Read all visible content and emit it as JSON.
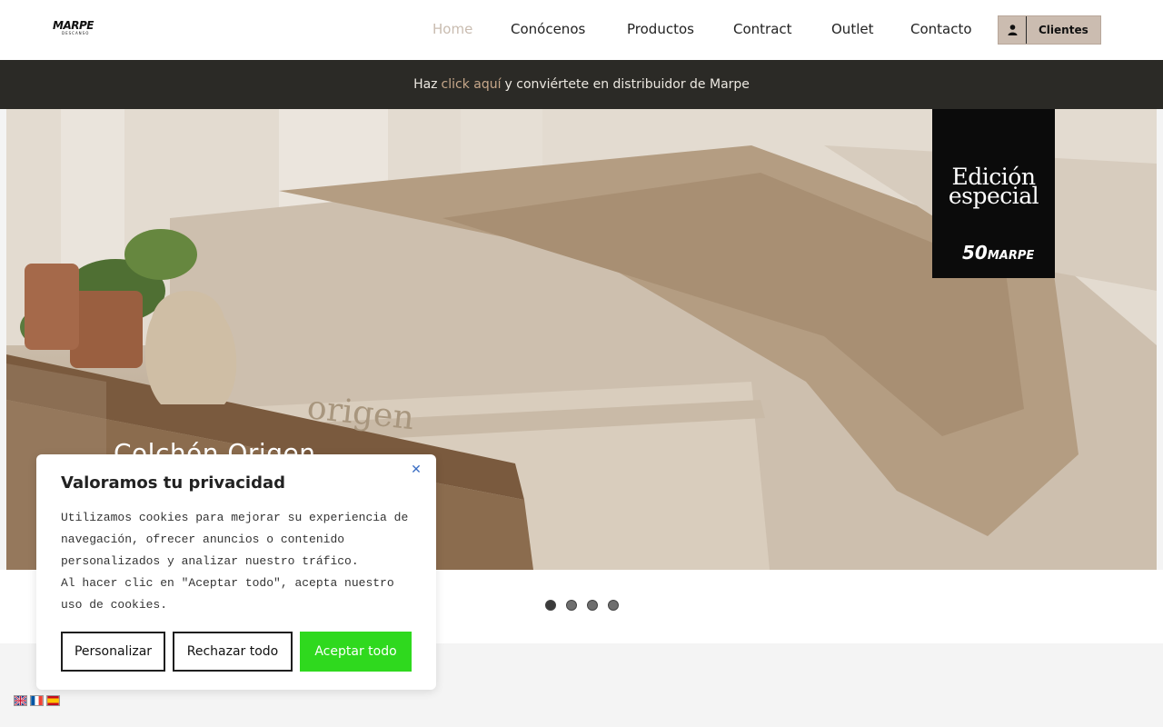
{
  "brand": {
    "name": "MARPE",
    "tagline": "DESCANSO"
  },
  "nav": {
    "items": [
      {
        "label": "Home",
        "active": true
      },
      {
        "label": "Conócenos",
        "active": false
      },
      {
        "label": "Productos",
        "active": false
      },
      {
        "label": "Contract",
        "active": false
      },
      {
        "label": "Outlet",
        "active": false
      },
      {
        "label": "Contacto",
        "active": false
      }
    ],
    "clientes_label": "Clientes"
  },
  "promo": {
    "before": "Haz",
    "link": "click aquí",
    "after": "y conviértete en distribuidor de Marpe"
  },
  "hero": {
    "badge_line1": "Edición",
    "badge_line2": "especial",
    "badge_logo_number": "50",
    "badge_logo_brand": "MARPE",
    "title": "Colchón Origen",
    "mattress_text": "origen"
  },
  "carousel": {
    "slides": 4,
    "active_index": 0
  },
  "cookie": {
    "title": "Valoramos tu privacidad",
    "body": "Utilizamos cookies para mejorar su experiencia de\nnavegación, ofrecer anuncios o contenido\npersonalizados y analizar nuestro tráfico.\nAl hacer clic en \"Aceptar todo\", acepta nuestro\nuso de cookies.",
    "customize_label": "Personalizar",
    "reject_label": "Rechazar todo",
    "accept_label": "Aceptar todo",
    "close_glyph": "✕"
  },
  "languages": [
    "en",
    "fr",
    "es"
  ],
  "colors": {
    "accent_link": "#c7a88b",
    "promo_bg": "#2b2a26",
    "accept_bg": "#2fd91e",
    "clientes_bg": "#cbbcb0",
    "nav_active": "#c9bcb0"
  }
}
